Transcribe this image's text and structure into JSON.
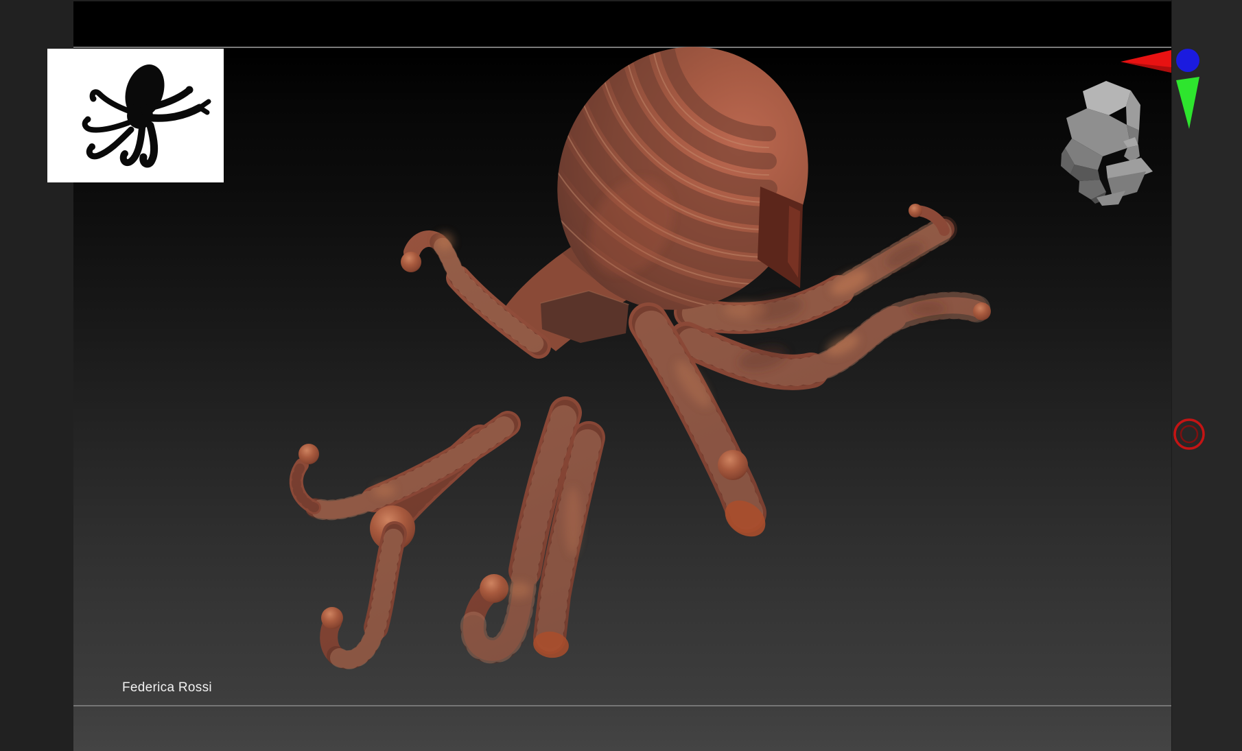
{
  "viewport": {
    "artist_label": "Federica Rossi",
    "background_top": "#000000",
    "background_bottom": "#444444",
    "divider_color": "#7b7b7b"
  },
  "model": {
    "subject": "octopus-sculpt",
    "base_color": "#8e4b39",
    "dark_band_color": "#6b3c30",
    "highlight_color": "#c67c5a",
    "tip_accent_color": "#aa4e2c"
  },
  "thumbnails": {
    "alpha_preview": {
      "content": "octopus-silhouette",
      "background": "#ffffff",
      "silhouette_color": "#0a0a0a"
    },
    "tool_preview": {
      "content": "low-poly-head",
      "color": "#9a9a9a"
    }
  },
  "nav_gizmo": {
    "red_arrow": "#e81212",
    "blue_sphere": "#1b1bdf",
    "green_cone": "#2ee52e"
  },
  "record_button": {
    "outer_ring": "#c41414",
    "inner_ring": "#7d1010"
  },
  "trays": {
    "left_color": "#212121",
    "right_color": "#272727"
  }
}
